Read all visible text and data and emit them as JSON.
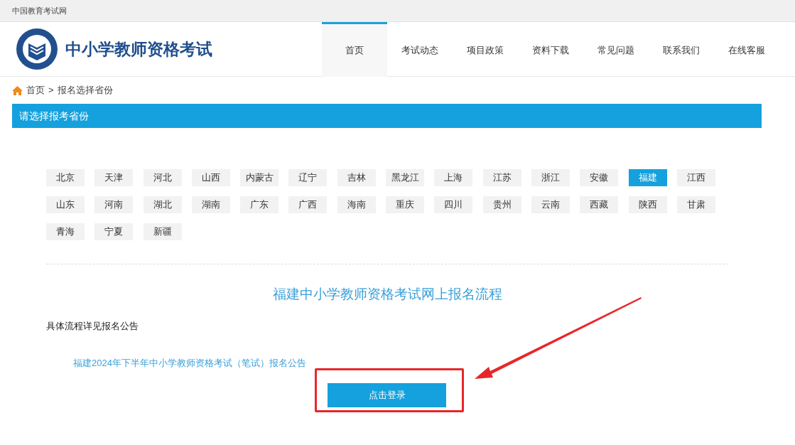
{
  "top_bar": {
    "site_name": "中国教育考试网"
  },
  "header": {
    "title": "中小学教师资格考试"
  },
  "nav": [
    {
      "label": "首页",
      "selected": true
    },
    {
      "label": "考试动态",
      "selected": false
    },
    {
      "label": "项目政策",
      "selected": false
    },
    {
      "label": "资料下载",
      "selected": false
    },
    {
      "label": "常见问题",
      "selected": false
    },
    {
      "label": "联系我们",
      "selected": false
    },
    {
      "label": "在线客服",
      "selected": false
    }
  ],
  "breadcrumb": [
    "首页",
    "报名选择省份"
  ],
  "breadcrumb_separator": ">",
  "section_title": "请选择报考省份",
  "provinces": [
    {
      "label": "北京",
      "selected": false
    },
    {
      "label": "天津",
      "selected": false
    },
    {
      "label": "河北",
      "selected": false
    },
    {
      "label": "山西",
      "selected": false
    },
    {
      "label": "内蒙古",
      "selected": false
    },
    {
      "label": "辽宁",
      "selected": false
    },
    {
      "label": "吉林",
      "selected": false
    },
    {
      "label": "黑龙江",
      "selected": false
    },
    {
      "label": "上海",
      "selected": false
    },
    {
      "label": "江苏",
      "selected": false
    },
    {
      "label": "浙江",
      "selected": false
    },
    {
      "label": "安徽",
      "selected": false
    },
    {
      "label": "福建",
      "selected": true
    },
    {
      "label": "江西",
      "selected": false
    },
    {
      "label": "山东",
      "selected": false
    },
    {
      "label": "河南",
      "selected": false
    },
    {
      "label": "湖北",
      "selected": false
    },
    {
      "label": "湖南",
      "selected": false
    },
    {
      "label": "广东",
      "selected": false
    },
    {
      "label": "广西",
      "selected": false
    },
    {
      "label": "海南",
      "selected": false
    },
    {
      "label": "重庆",
      "selected": false
    },
    {
      "label": "四川",
      "selected": false
    },
    {
      "label": "贵州",
      "selected": false
    },
    {
      "label": "云南",
      "selected": false
    },
    {
      "label": "西藏",
      "selected": false
    },
    {
      "label": "陕西",
      "selected": false
    },
    {
      "label": "甘肃",
      "selected": false
    },
    {
      "label": "青海",
      "selected": false
    },
    {
      "label": "宁夏",
      "selected": false
    },
    {
      "label": "新疆",
      "selected": false
    }
  ],
  "process": {
    "title": "福建中小学教师资格考试网上报名流程",
    "note": "具体流程详见报名公告",
    "link": "福建2024年下半年中小学教师资格考试（笔试）报名公告",
    "button": "点击登录"
  }
}
